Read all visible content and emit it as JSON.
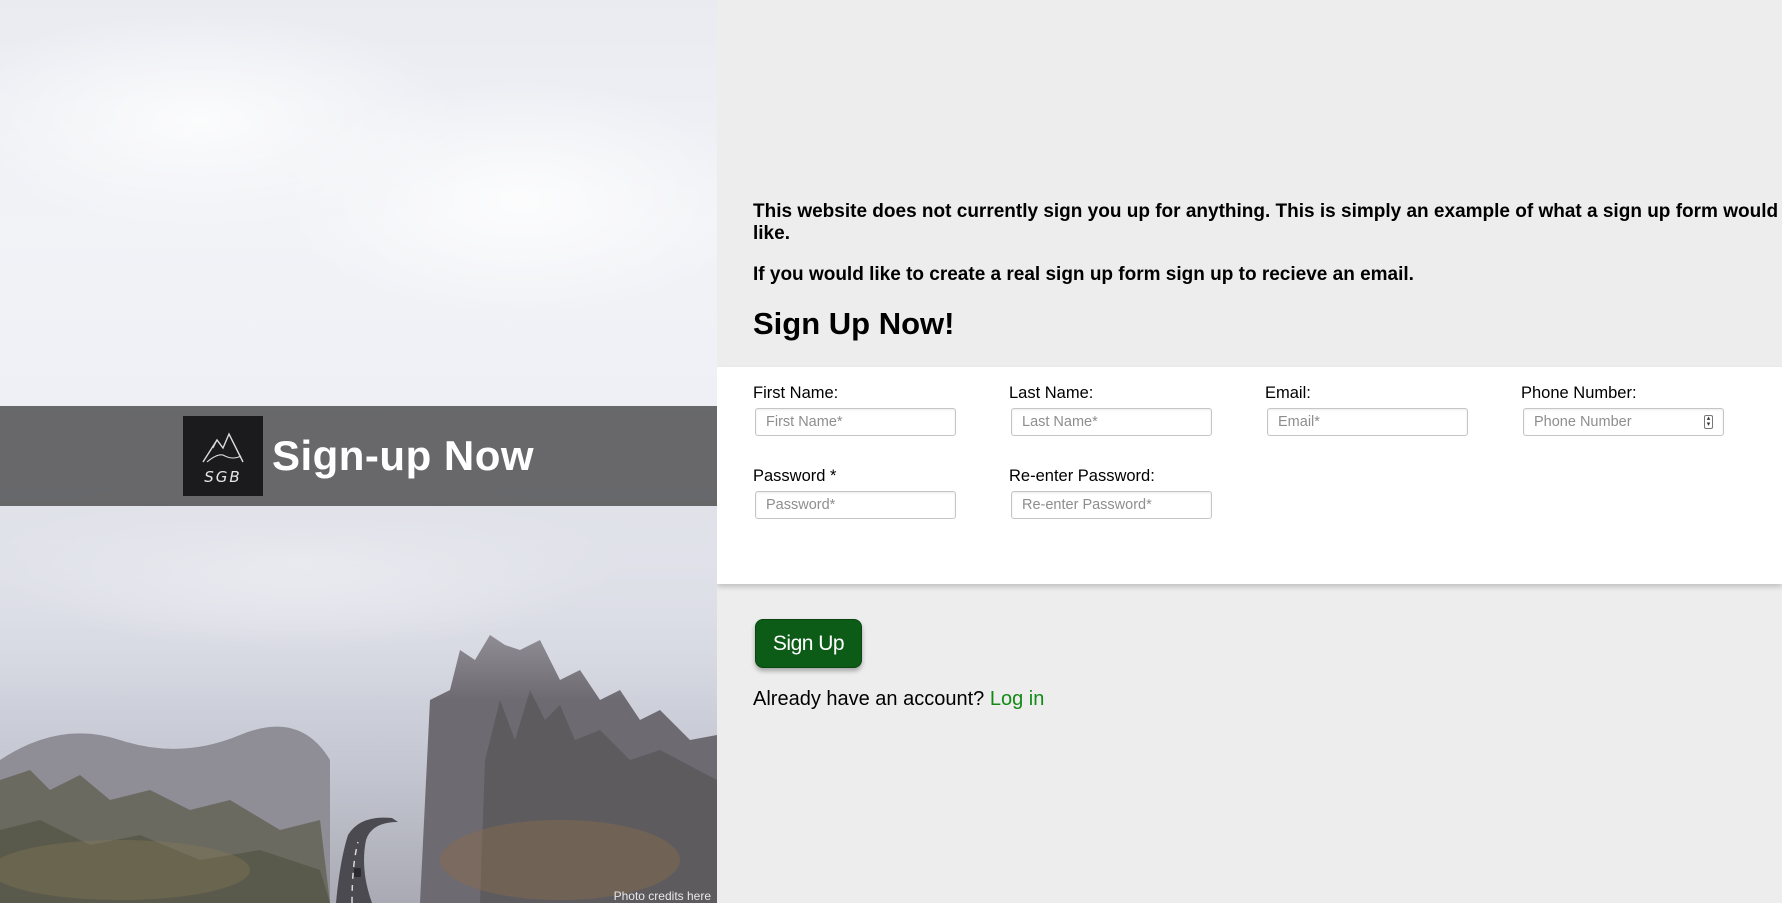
{
  "hero": {
    "logo_text": "SGB",
    "title": "Sign-up Now",
    "photo_credit": "Photo credits here"
  },
  "intro": {
    "line1": "This website does not currently sign you up for anything. This is simply an example of what a sign up form would like.",
    "line2": "If you would like to create a real sign up form sign up to recieve an email."
  },
  "form": {
    "heading": "Sign Up Now!",
    "first_name": {
      "label": "First Name:",
      "placeholder": "First Name*",
      "value": ""
    },
    "last_name": {
      "label": "Last Name:",
      "placeholder": "Last Name*",
      "value": ""
    },
    "email": {
      "label": "Email:",
      "placeholder": "Email*",
      "value": ""
    },
    "phone": {
      "label": "Phone Number:",
      "placeholder": "Phone Number",
      "value": ""
    },
    "password": {
      "label": "Password *",
      "placeholder": "Password*",
      "value": ""
    },
    "reenter_password": {
      "label": "Re-enter Password:",
      "placeholder": "Re-enter Password*",
      "value": ""
    },
    "submit_label": "Sign Up"
  },
  "login": {
    "prompt": "Already have an account?",
    "link_label": "Log in"
  },
  "colors": {
    "button_bg": "#0c5c18",
    "link": "#128a14",
    "panel_bg": "#ededed"
  }
}
